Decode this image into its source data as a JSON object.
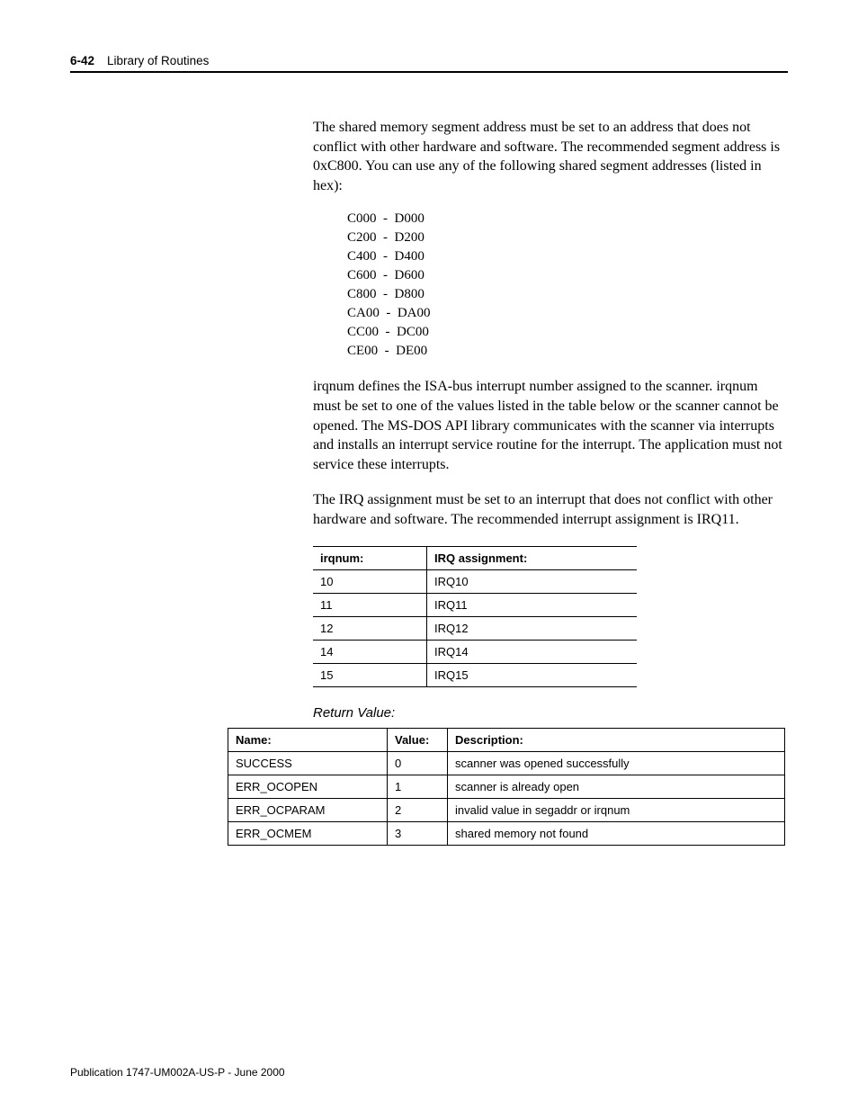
{
  "header": {
    "page": "6-42",
    "title": "Library of Routines"
  },
  "paragraphs": {
    "p1": "The shared memory segment address must be set to an address that does not conflict with other hardware and software. The recommended segment address is 0xC800. You can use any of the following shared segment addresses (listed in hex):",
    "p2": "irqnum defines the ISA-bus interrupt number assigned to the scanner. irqnum must be set to one of the values listed in the table below or the scanner cannot be opened. The MS-DOS API library communicates with the scanner via interrupts and installs an interrupt service routine for the interrupt. The application must not service these interrupts.",
    "p3": "The IRQ assignment must be set to an interrupt that does not conflict with other hardware and software. The recommended interrupt assignment is IRQ11."
  },
  "addresses": [
    "C000  -  D000",
    "C200  -  D200",
    "C400  -  D400",
    "C600  -  D600",
    "C800  -  D800",
    "CA00  -  DA00",
    "CC00  -  DC00",
    "CE00  -  DE00"
  ],
  "irq_table": {
    "headers": {
      "c1": "irqnum:",
      "c2": "IRQ assignment:"
    },
    "rows": [
      {
        "num": "10",
        "irq": "IRQ10"
      },
      {
        "num": "11",
        "irq": "IRQ11"
      },
      {
        "num": "12",
        "irq": "IRQ12"
      },
      {
        "num": "14",
        "irq": "IRQ14"
      },
      {
        "num": "15",
        "irq": "IRQ15"
      }
    ]
  },
  "return_value": {
    "title": "Return Value:",
    "headers": {
      "c1": "Name:",
      "c2": "Value:",
      "c3": "Description:"
    },
    "rows": [
      {
        "name": "SUCCESS",
        "value": "0",
        "desc": "scanner was opened successfully"
      },
      {
        "name": "ERR_OCOPEN",
        "value": "1",
        "desc": "scanner is already open"
      },
      {
        "name": "ERR_OCPARAM",
        "value": "2",
        "desc": "invalid value in segaddr or irqnum"
      },
      {
        "name": "ERR_OCMEM",
        "value": "3",
        "desc": "shared memory not found"
      }
    ]
  },
  "footer": "Publication 1747-UM002A-US-P - June 2000"
}
